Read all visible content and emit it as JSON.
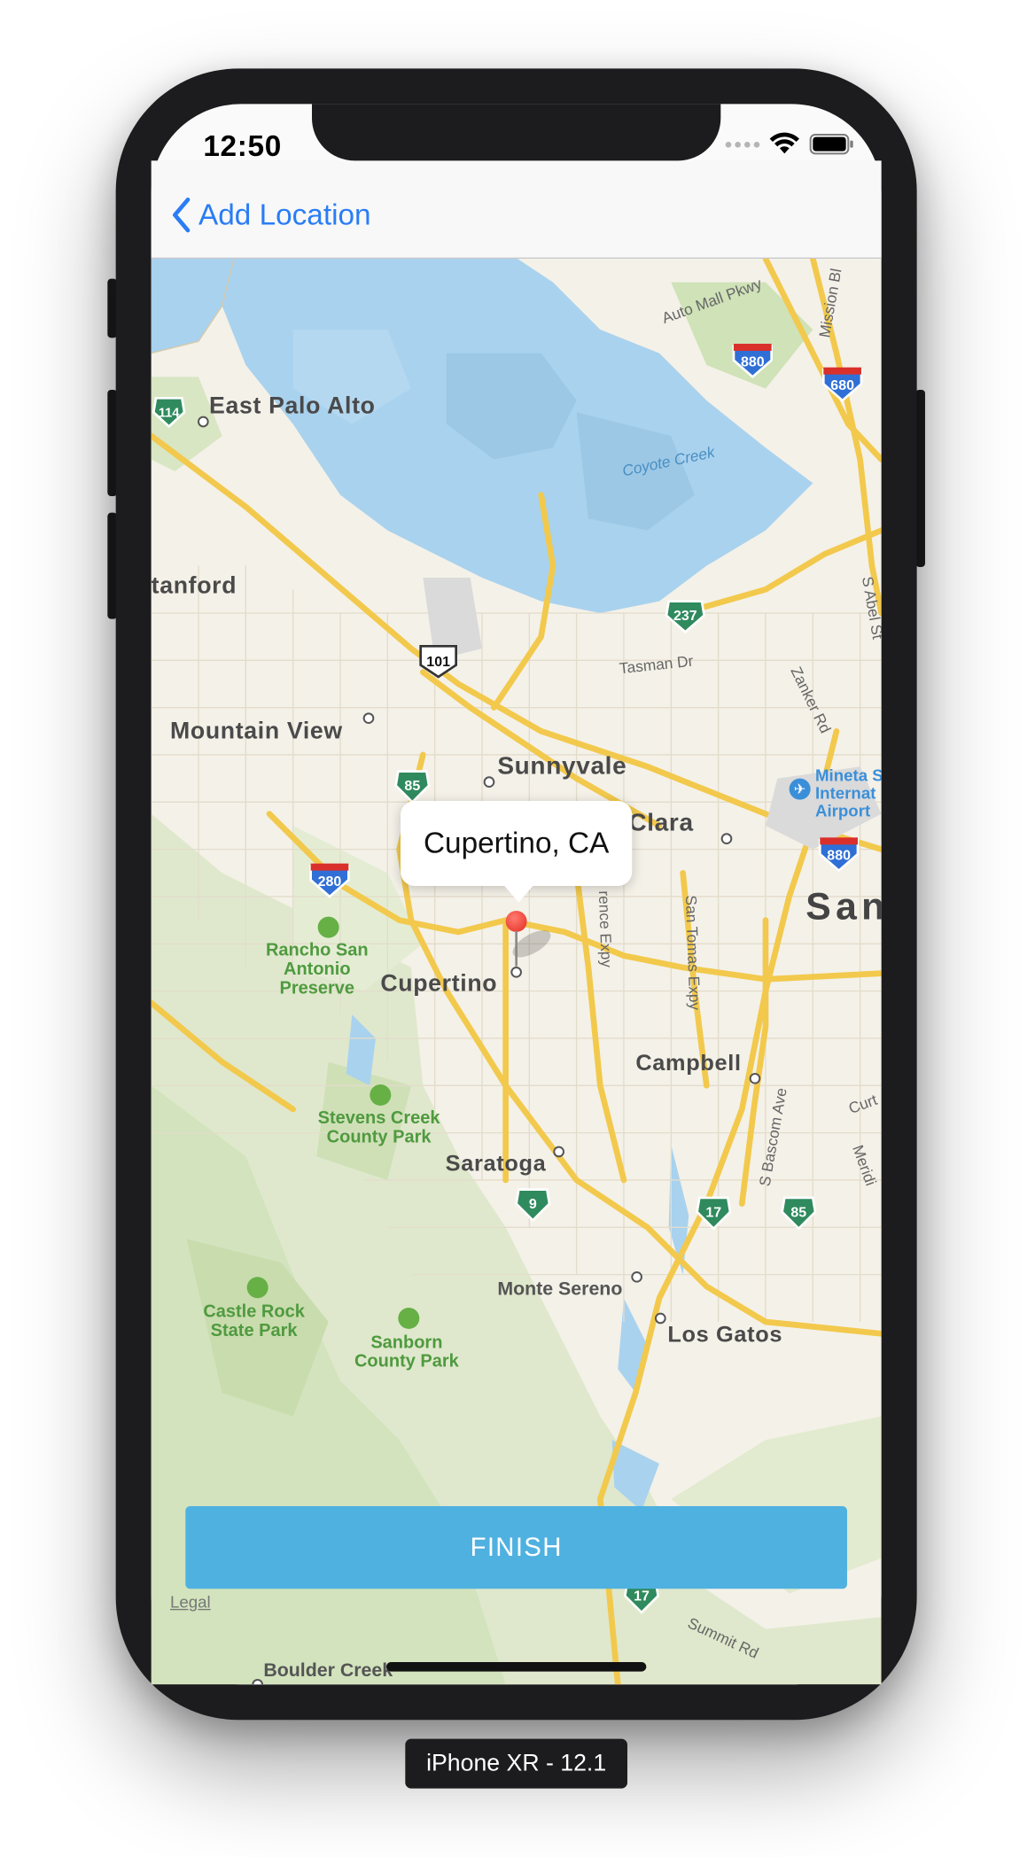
{
  "status_bar": {
    "time": "12:50"
  },
  "navbar": {
    "back_label": "Add Location"
  },
  "map": {
    "callout": "Cupertino, CA",
    "cities": {
      "east_palo_alto": "East Palo Alto",
      "stanford": "tanford",
      "mountain_view": "Mountain View",
      "sunnyvale": "Sunnyvale",
      "santa_clara": "Santa Clara",
      "san_jose": "San",
      "cupertino": "Cupertino",
      "campbell": "Campbell",
      "saratoga": "Saratoga",
      "monte_sereno": "Monte Sereno",
      "los_gatos": "Los Gatos",
      "boulder_creek": "Boulder Creek"
    },
    "parks": {
      "rancho": "Rancho San\nAntonio\nPreserve",
      "stevens": "Stevens Creek\nCounty Park",
      "castle": "Castle Rock\nState Park",
      "sanborn": "Sanborn\nCounty Park"
    },
    "roads": {
      "auto_mall": "Auto Mall Pkwy",
      "mission": "Mission Bl",
      "coyote": "Coyote Creek",
      "tasman": "Tasman Dr",
      "zanker": "Zanker Rd",
      "abel": "S Abel St",
      "lawrence": "rence Expy",
      "san_tomas": "San Tomas Expy",
      "bascom": "S Bascom Ave",
      "summit": "Summit Rd",
      "curt": "Curt",
      "meridian": "Meridi",
      "airport": "Mineta S\nInternat\nAirport"
    },
    "shields": [
      "114",
      "101",
      "237",
      "880",
      "680",
      "85",
      "280",
      "880",
      "9",
      "17",
      "85",
      "17"
    ],
    "legal": "Legal"
  },
  "finish_label": "FINISH",
  "device_label": "iPhone XR - 12.1"
}
